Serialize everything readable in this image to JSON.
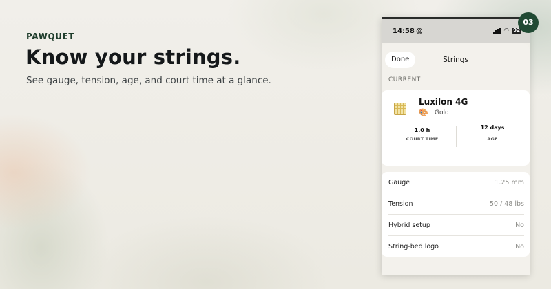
{
  "brand": "PAWQUET",
  "headline": "Know your strings.",
  "subheadline": "See gauge, tension, age, and court time at a glance.",
  "badge": "03",
  "phone": {
    "status": {
      "time": "14:58",
      "battery": "92"
    },
    "nav": {
      "done_label": "Done",
      "title": "Strings"
    },
    "section_label": "CURRENT",
    "string": {
      "name": "Luxilon 4G",
      "color": "Gold",
      "icon": "string-bed-icon",
      "stats": [
        {
          "value": "1.0 h",
          "label": "COURT TIME"
        },
        {
          "value": "12 days",
          "label": "AGE"
        }
      ]
    },
    "details": [
      {
        "label": "Gauge",
        "value": "1.25 mm"
      },
      {
        "label": "Tension",
        "value": "50 / 48 lbs"
      },
      {
        "label": "Hybrid setup",
        "value": "No"
      },
      {
        "label": "String-bed logo",
        "value": "No"
      }
    ]
  },
  "colors": {
    "accent": "#204a33",
    "brand_text": "#1f3d2c"
  }
}
